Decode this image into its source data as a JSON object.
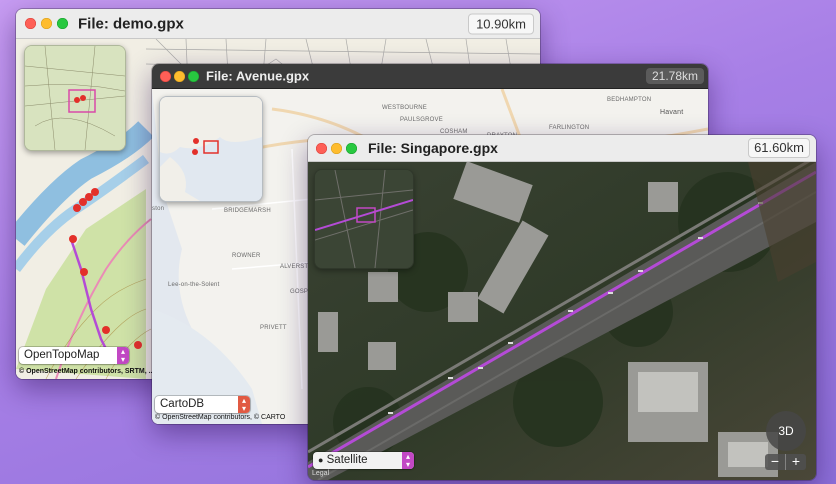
{
  "windows": [
    {
      "id": "demo",
      "title": "File: demo.gpx",
      "distance": "10.90km",
      "map_type": "OpenTopoMap",
      "attribution": "© OpenStreetMap contributors, SRTM, ..."
    },
    {
      "id": "avenue",
      "title": "File: Avenue.gpx",
      "distance": "21.78km",
      "map_type": "CartoDB",
      "attribution": "© OpenStreetMap contributors, © CARTO",
      "place_labels": [
        "Lee-on-the-Solent",
        "BRIDGEMARSH",
        "ROWNER",
        "GOSPORT",
        "PRIVETT",
        "ALVERSTOKE",
        "PAULSGROVE",
        "BEDHAMPTON",
        "FARLINGTON",
        "Havant",
        "DRAYTON",
        "WESTBOURNE",
        "COSHAM",
        "ston"
      ]
    },
    {
      "id": "singapore",
      "title": "File: Singapore.gpx",
      "distance": "61.60km",
      "map_type": "Satellite",
      "compass_label": "3D",
      "zoom_out": "−",
      "zoom_in": "+",
      "legal": "Legal"
    }
  ],
  "colors": {
    "track_purple": "#b44bd6",
    "waypoint_red": "#e3302a",
    "accent": "#c248c4"
  }
}
